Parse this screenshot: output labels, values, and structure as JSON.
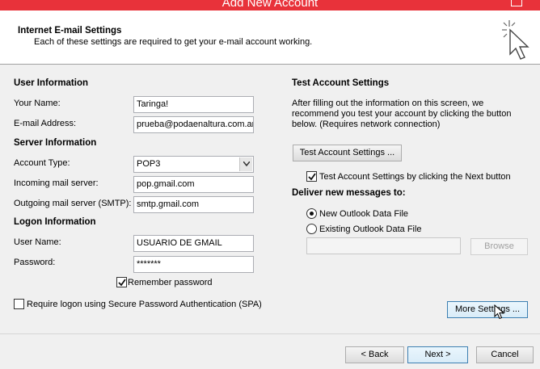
{
  "window": {
    "title": "Add New Account"
  },
  "header": {
    "title": "Internet E-mail Settings",
    "subtitle": "Each of these settings are required to get your e-mail account working."
  },
  "user_info": {
    "heading": "User Information",
    "name_label": "Your Name:",
    "name_value": "Taringa!",
    "email_label": "E-mail Address:",
    "email_value": "prueba@podaenaltura.com.ar"
  },
  "server_info": {
    "heading": "Server Information",
    "account_type_label": "Account Type:",
    "account_type_value": "POP3",
    "incoming_label": "Incoming mail server:",
    "incoming_value": "pop.gmail.com",
    "outgoing_label": "Outgoing mail server (SMTP):",
    "outgoing_value": "smtp.gmail.com"
  },
  "logon_info": {
    "heading": "Logon Information",
    "username_label": "User Name:",
    "username_value": "USUARIO DE GMAIL",
    "password_label": "Password:",
    "password_value": "*******",
    "remember_label": "Remember password",
    "remember_checked": true,
    "spa_label": "Require logon using Secure Password Authentication (SPA)",
    "spa_checked": false
  },
  "test_settings": {
    "heading": "Test Account Settings",
    "description_line1": "After filling out the information on this screen, we",
    "description_line2": "recommend you test your account by clicking the button",
    "description_line3": "below. (Requires network connection)",
    "test_button": "Test Account Settings ...",
    "auto_test_label": "Test Account Settings by clicking the Next button",
    "auto_test_checked": true
  },
  "deliver": {
    "heading": "Deliver new messages to:",
    "new_file_label": "New Outlook Data File",
    "existing_file_label": "Existing Outlook Data File",
    "selected": "new",
    "existing_path": "",
    "browse_button": "Browse"
  },
  "buttons": {
    "more_settings": "More Settings ...",
    "back": "< Back",
    "next": "Next >",
    "cancel": "Cancel"
  }
}
